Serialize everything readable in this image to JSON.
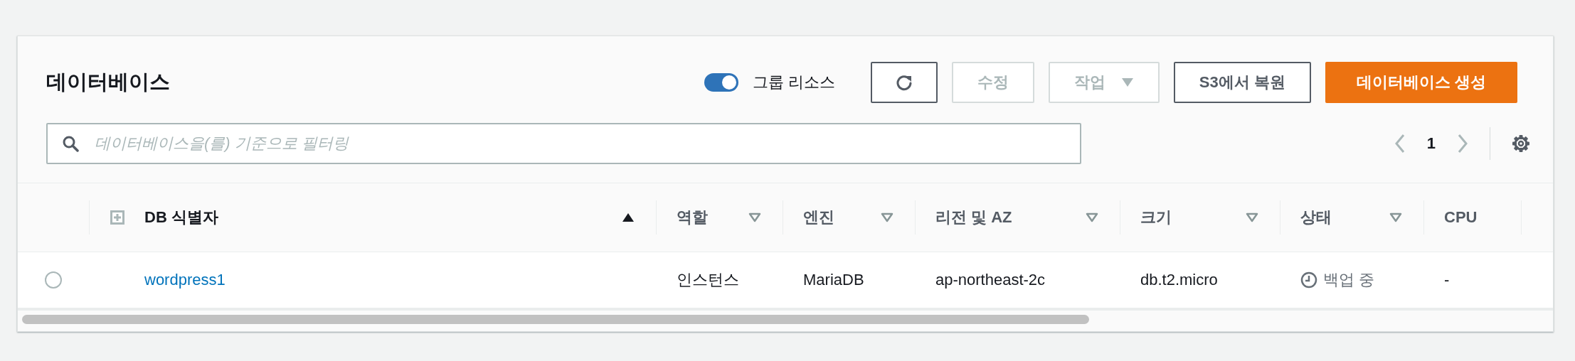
{
  "panel": {
    "title": "데이터베이스",
    "group_toggle": {
      "label": "그룹 리소스",
      "on": true
    },
    "buttons": [
      {
        "kind": "refresh",
        "disabled": false
      },
      {
        "kind": "text",
        "label": "수정",
        "disabled": true
      },
      {
        "kind": "dropdown",
        "label": "작업",
        "disabled": true
      },
      {
        "kind": "text",
        "label": "S3에서 복원",
        "disabled": false
      },
      {
        "kind": "primary",
        "label": "데이터베이스 생성",
        "disabled": false
      }
    ],
    "search": {
      "placeholder": "데이터베이스을(를) 기준으로 필터링"
    },
    "pagination": {
      "page": "1",
      "prev_disabled": true,
      "next_disabled": true
    }
  },
  "table": {
    "columns": [
      {
        "label": "DB 식별자",
        "sortable": true,
        "sorted": true
      },
      {
        "label": "역할",
        "sortable": true,
        "sorted": false
      },
      {
        "label": "엔진",
        "sortable": true,
        "sorted": false
      },
      {
        "label": "리전 및 AZ",
        "sortable": true,
        "sorted": false
      },
      {
        "label": "크기",
        "sortable": true,
        "sorted": false
      },
      {
        "label": "상태",
        "sortable": true,
        "sorted": false
      },
      {
        "label": "CPU",
        "sortable": false,
        "sorted": false
      }
    ],
    "rows": [
      {
        "selected": false,
        "cells": [
          "wordpress1",
          "인스턴스",
          "MariaDB",
          "ap-northeast-2c",
          "db.t2.micro",
          {
            "kind": "backup",
            "text": "백업 중"
          },
          "-"
        ]
      }
    ]
  }
}
